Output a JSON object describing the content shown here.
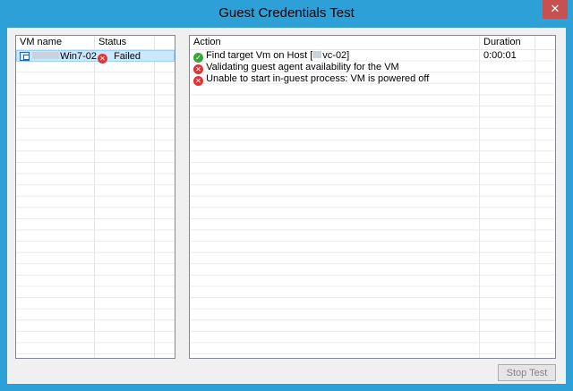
{
  "window": {
    "title": "Guest Credentials Test",
    "close_glyph": "✕"
  },
  "vm_list": {
    "columns": [
      "VM name",
      "Status"
    ],
    "rows": [
      {
        "name": "Win7-02",
        "status": "Failed",
        "status_icon": "error-icon",
        "selected": true
      }
    ]
  },
  "actions": {
    "columns": [
      "Action",
      "Duration"
    ],
    "rows": [
      {
        "icon": "success-icon",
        "text_pre": "Find target Vm on Host [",
        "text_post": "vc-02]",
        "duration": "0:00:01"
      },
      {
        "icon": "error-icon",
        "text": "Validating guest agent availability for the VM",
        "duration": ""
      },
      {
        "icon": "error-icon",
        "text": "Unable to start in-guest process: VM is powered off",
        "duration": ""
      }
    ]
  },
  "footer": {
    "stop_label": "Stop Test"
  },
  "colors": {
    "title_bar": "#2ea0d8",
    "close_button": "#c75050",
    "selection": "#cce8ff",
    "success": "#3aa63a",
    "error": "#e03535"
  }
}
